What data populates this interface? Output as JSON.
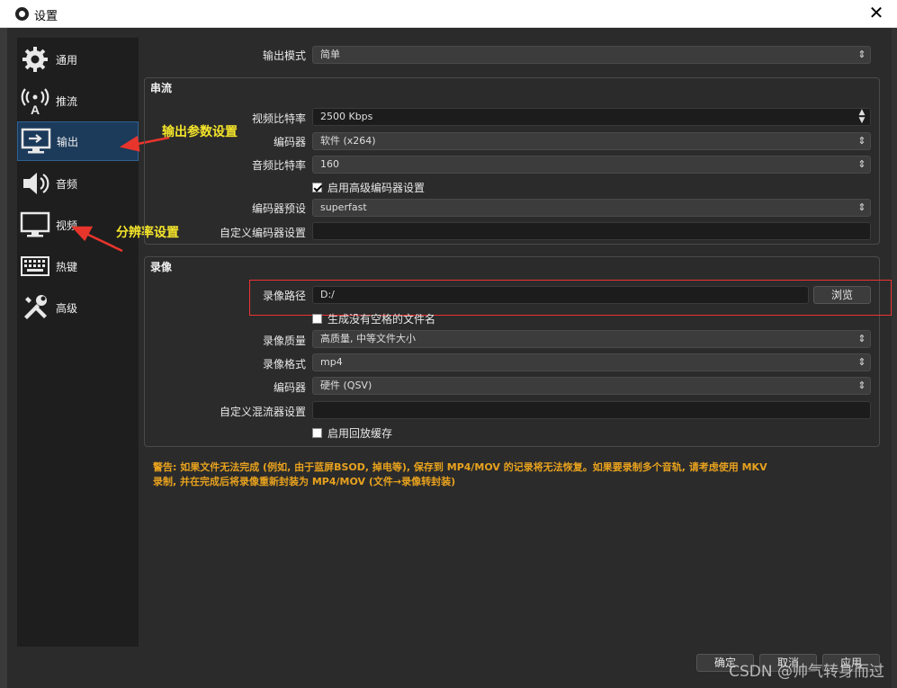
{
  "window": {
    "title": "设置",
    "close_icon": "close-icon"
  },
  "sidebar": {
    "items": [
      {
        "label": "通用",
        "icon": "gear-icon"
      },
      {
        "label": "推流",
        "icon": "antenna-icon"
      },
      {
        "label": "输出",
        "icon": "monitor-output-icon",
        "active": true
      },
      {
        "label": "音频",
        "icon": "speaker-icon"
      },
      {
        "label": "视频",
        "icon": "monitor-icon"
      },
      {
        "label": "热键",
        "icon": "keyboard-icon"
      },
      {
        "label": "高级",
        "icon": "tools-icon"
      }
    ]
  },
  "annotations": {
    "output_note": "输出参数设置",
    "video_note": "分辨率设置"
  },
  "output_mode": {
    "label": "输出模式",
    "value": "简单"
  },
  "streaming": {
    "title": "串流",
    "video_bitrate": {
      "label": "视频比特率",
      "value": "2500 Kbps"
    },
    "encoder": {
      "label": "编码器",
      "value": "软件 (x264)"
    },
    "audio_bitrate": {
      "label": "音频比特率",
      "value": "160"
    },
    "advanced_encoder": {
      "label": "启用高级编码器设置",
      "checked": true
    },
    "encoder_preset": {
      "label": "编码器预设",
      "value": "superfast"
    },
    "custom_encoder": {
      "label": "自定义编码器设置",
      "value": ""
    }
  },
  "recording": {
    "title": "录像",
    "path": {
      "label": "录像路径",
      "value": "D:/",
      "browse": "浏览"
    },
    "no_space": {
      "label": "生成没有空格的文件名",
      "checked": false
    },
    "quality": {
      "label": "录像质量",
      "value": "高质量, 中等文件大小"
    },
    "format": {
      "label": "录像格式",
      "value": "mp4"
    },
    "encoder": {
      "label": "编码器",
      "value": "硬件 (QSV)"
    },
    "custom_muxer": {
      "label": "自定义混流器设置",
      "value": ""
    },
    "replay_buffer": {
      "label": "启用回放缓存",
      "checked": false
    }
  },
  "warning": {
    "line1": "警告: 如果文件无法完成 (例如, 由于蓝屏BSOD, 掉电等), 保存到 MP4/MOV 的记录将无法恢复。如果要录制多个音轨, 请考虑使用 MKV",
    "line2": "录制, 并在完成后将录像重新封装为 MP4/MOV (文件→录像转封装)"
  },
  "footer": {
    "ok": "确定",
    "cancel": "取消",
    "apply": "应用"
  },
  "watermark": "CSDN @帅气转身而过",
  "colors": {
    "accent_active": "#1c3a5a",
    "annotation": "#f5e52b",
    "warning": "#e8a21e",
    "highlight": "#e33333"
  }
}
